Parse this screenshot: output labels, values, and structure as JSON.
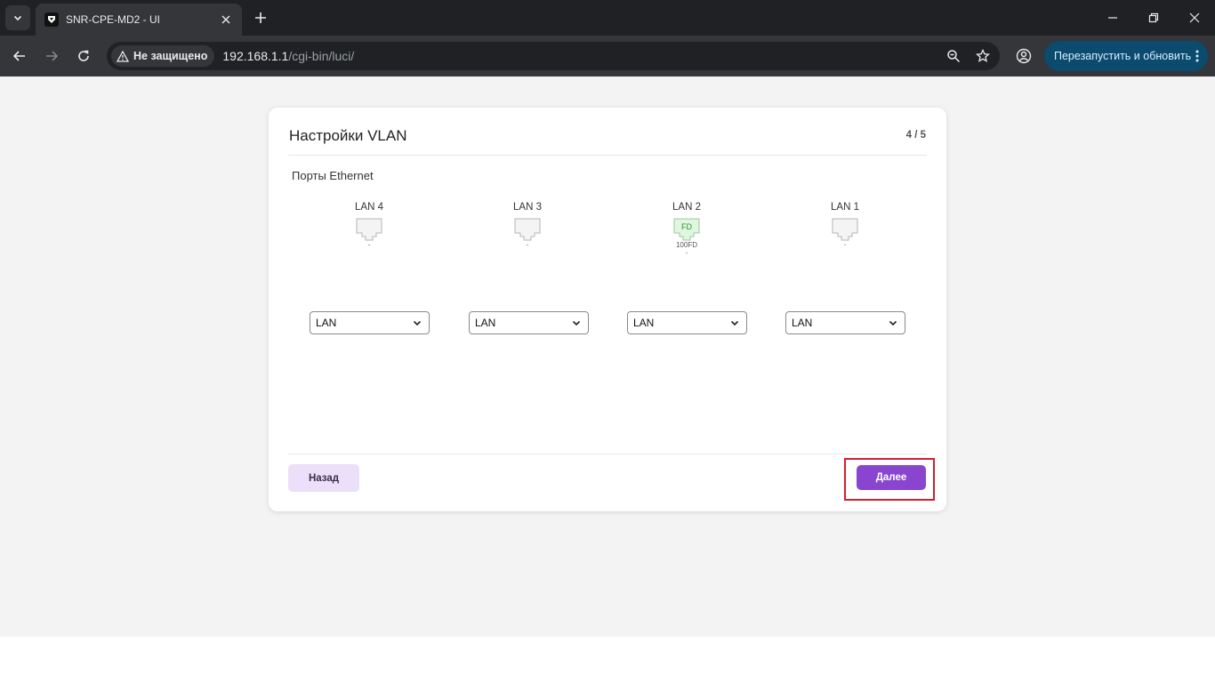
{
  "browser": {
    "tab_title": "SNR-CPE-MD2 - UI",
    "security_label": "Не защищено",
    "url_host": "192.168.1.1",
    "url_path": "/cgi-bin/luci/",
    "update_button_label": "Перезапустить и обновить",
    "update_button_color": "#0b4b6e"
  },
  "wizard": {
    "title": "Настройки VLAN",
    "step": "4 / 5",
    "section_label": "Порты Ethernet",
    "ports": [
      {
        "name": "LAN 4",
        "link": "",
        "speed": "",
        "status": "-",
        "vlan": "LAN"
      },
      {
        "name": "LAN 3",
        "link": "",
        "speed": "",
        "status": "-",
        "vlan": "LAN"
      },
      {
        "name": "LAN 2",
        "link": "FD",
        "speed": "100FD",
        "status": "-",
        "vlan": "LAN"
      },
      {
        "name": "LAN 1",
        "link": "",
        "speed": "",
        "status": "-",
        "vlan": "LAN"
      }
    ],
    "back_label": "Назад",
    "next_label": "Далее",
    "accent_color": "#8a45d0",
    "highlight_color": "#d11f2f"
  }
}
